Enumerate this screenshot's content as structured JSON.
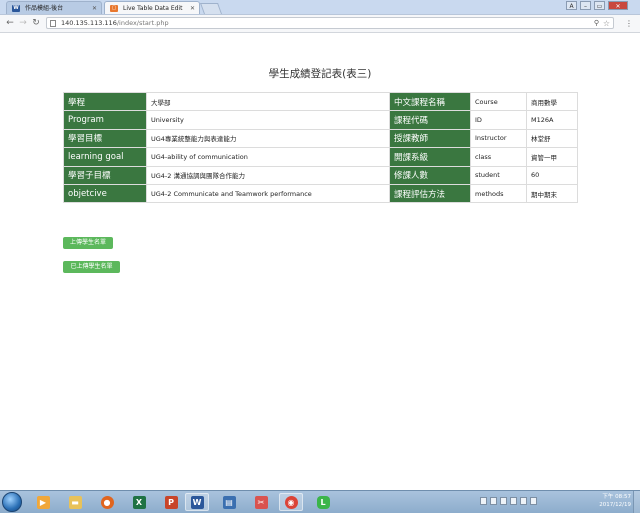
{
  "browser": {
    "tabs": [
      {
        "label": "作品模組-後台",
        "icon": "w-icon"
      },
      {
        "label": "Live Table Data Edit",
        "icon": "page-orange-icon"
      }
    ],
    "address": {
      "host": "140.135.113.116",
      "path": "/index/start.php"
    }
  },
  "page": {
    "title": "學生成績登記表(表三)",
    "table": [
      [
        "學程",
        "大學部",
        "中文課程名稱",
        "Course",
        "商用數學"
      ],
      [
        "Program",
        "University",
        "課程代碼",
        "ID",
        "M126A"
      ],
      [
        "學習目標",
        "UG4專業統整能力與表達能力",
        "授課教師",
        "Instructor",
        "林堂舒"
      ],
      [
        "learning goal",
        "UG4-ability of communication",
        "開課系級",
        "class",
        "資管一甲"
      ],
      [
        "學習子目標",
        "UG4-2 溝通協調與團隊合作能力",
        "修課人數",
        "student",
        "60"
      ],
      [
        "objetcive",
        "UG4-2 Communicate and Teamwork performance",
        "課程評估方法",
        "methods",
        "期中期末"
      ]
    ],
    "buttons": {
      "upload": "上傳學生名單",
      "uploaded": "已上傳學生名單"
    }
  },
  "taskbar": {
    "clock": {
      "time": "下午 08:57",
      "date": "2017/12/19"
    }
  }
}
